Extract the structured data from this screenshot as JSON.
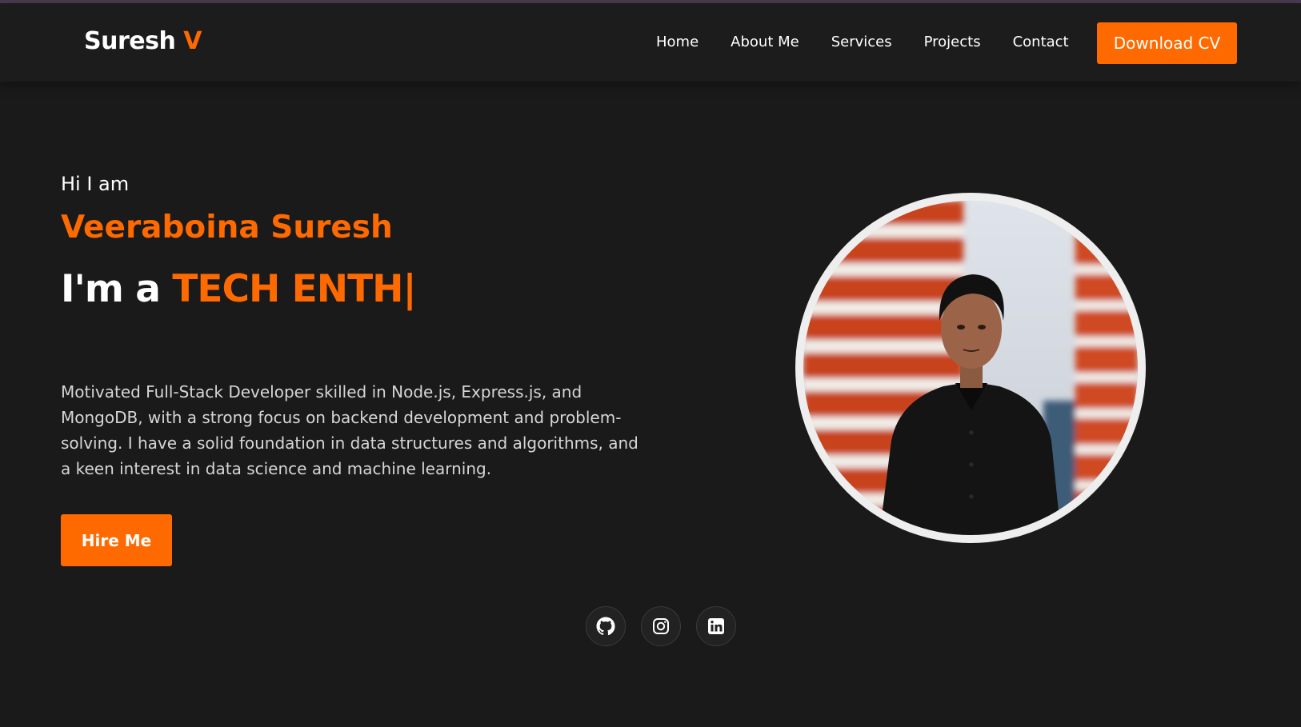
{
  "nav": {
    "logo_main": "Suresh",
    "logo_accent": "V",
    "links": [
      {
        "label": "Home"
      },
      {
        "label": "About Me"
      },
      {
        "label": "Services"
      },
      {
        "label": "Projects"
      },
      {
        "label": "Contact"
      }
    ],
    "cta_label": "Download CV"
  },
  "hero": {
    "greeting": "Hi I am",
    "name": "Veeraboina Suresh",
    "tagline_prefix": "I'm a",
    "tagline_role": "TECH ENTH",
    "caret": "|",
    "bio": "Motivated Full-Stack Developer skilled in Node.js, Express.js, and MongoDB, with a strong focus on backend development and problem-solving. I have a solid foundation in data structures and algorithms, and a keen interest in data science and machine learning.",
    "cta_label": "Hire Me"
  },
  "social": [
    {
      "icon": "github-icon"
    },
    {
      "icon": "instagram-icon"
    },
    {
      "icon": "linkedin-icon"
    }
  ],
  "colors": {
    "accent": "#ff6a00",
    "background": "#1a1a1b",
    "navbar": "#1c1c1d",
    "text": "#ffffff",
    "muted_text": "#d6d6d6"
  }
}
